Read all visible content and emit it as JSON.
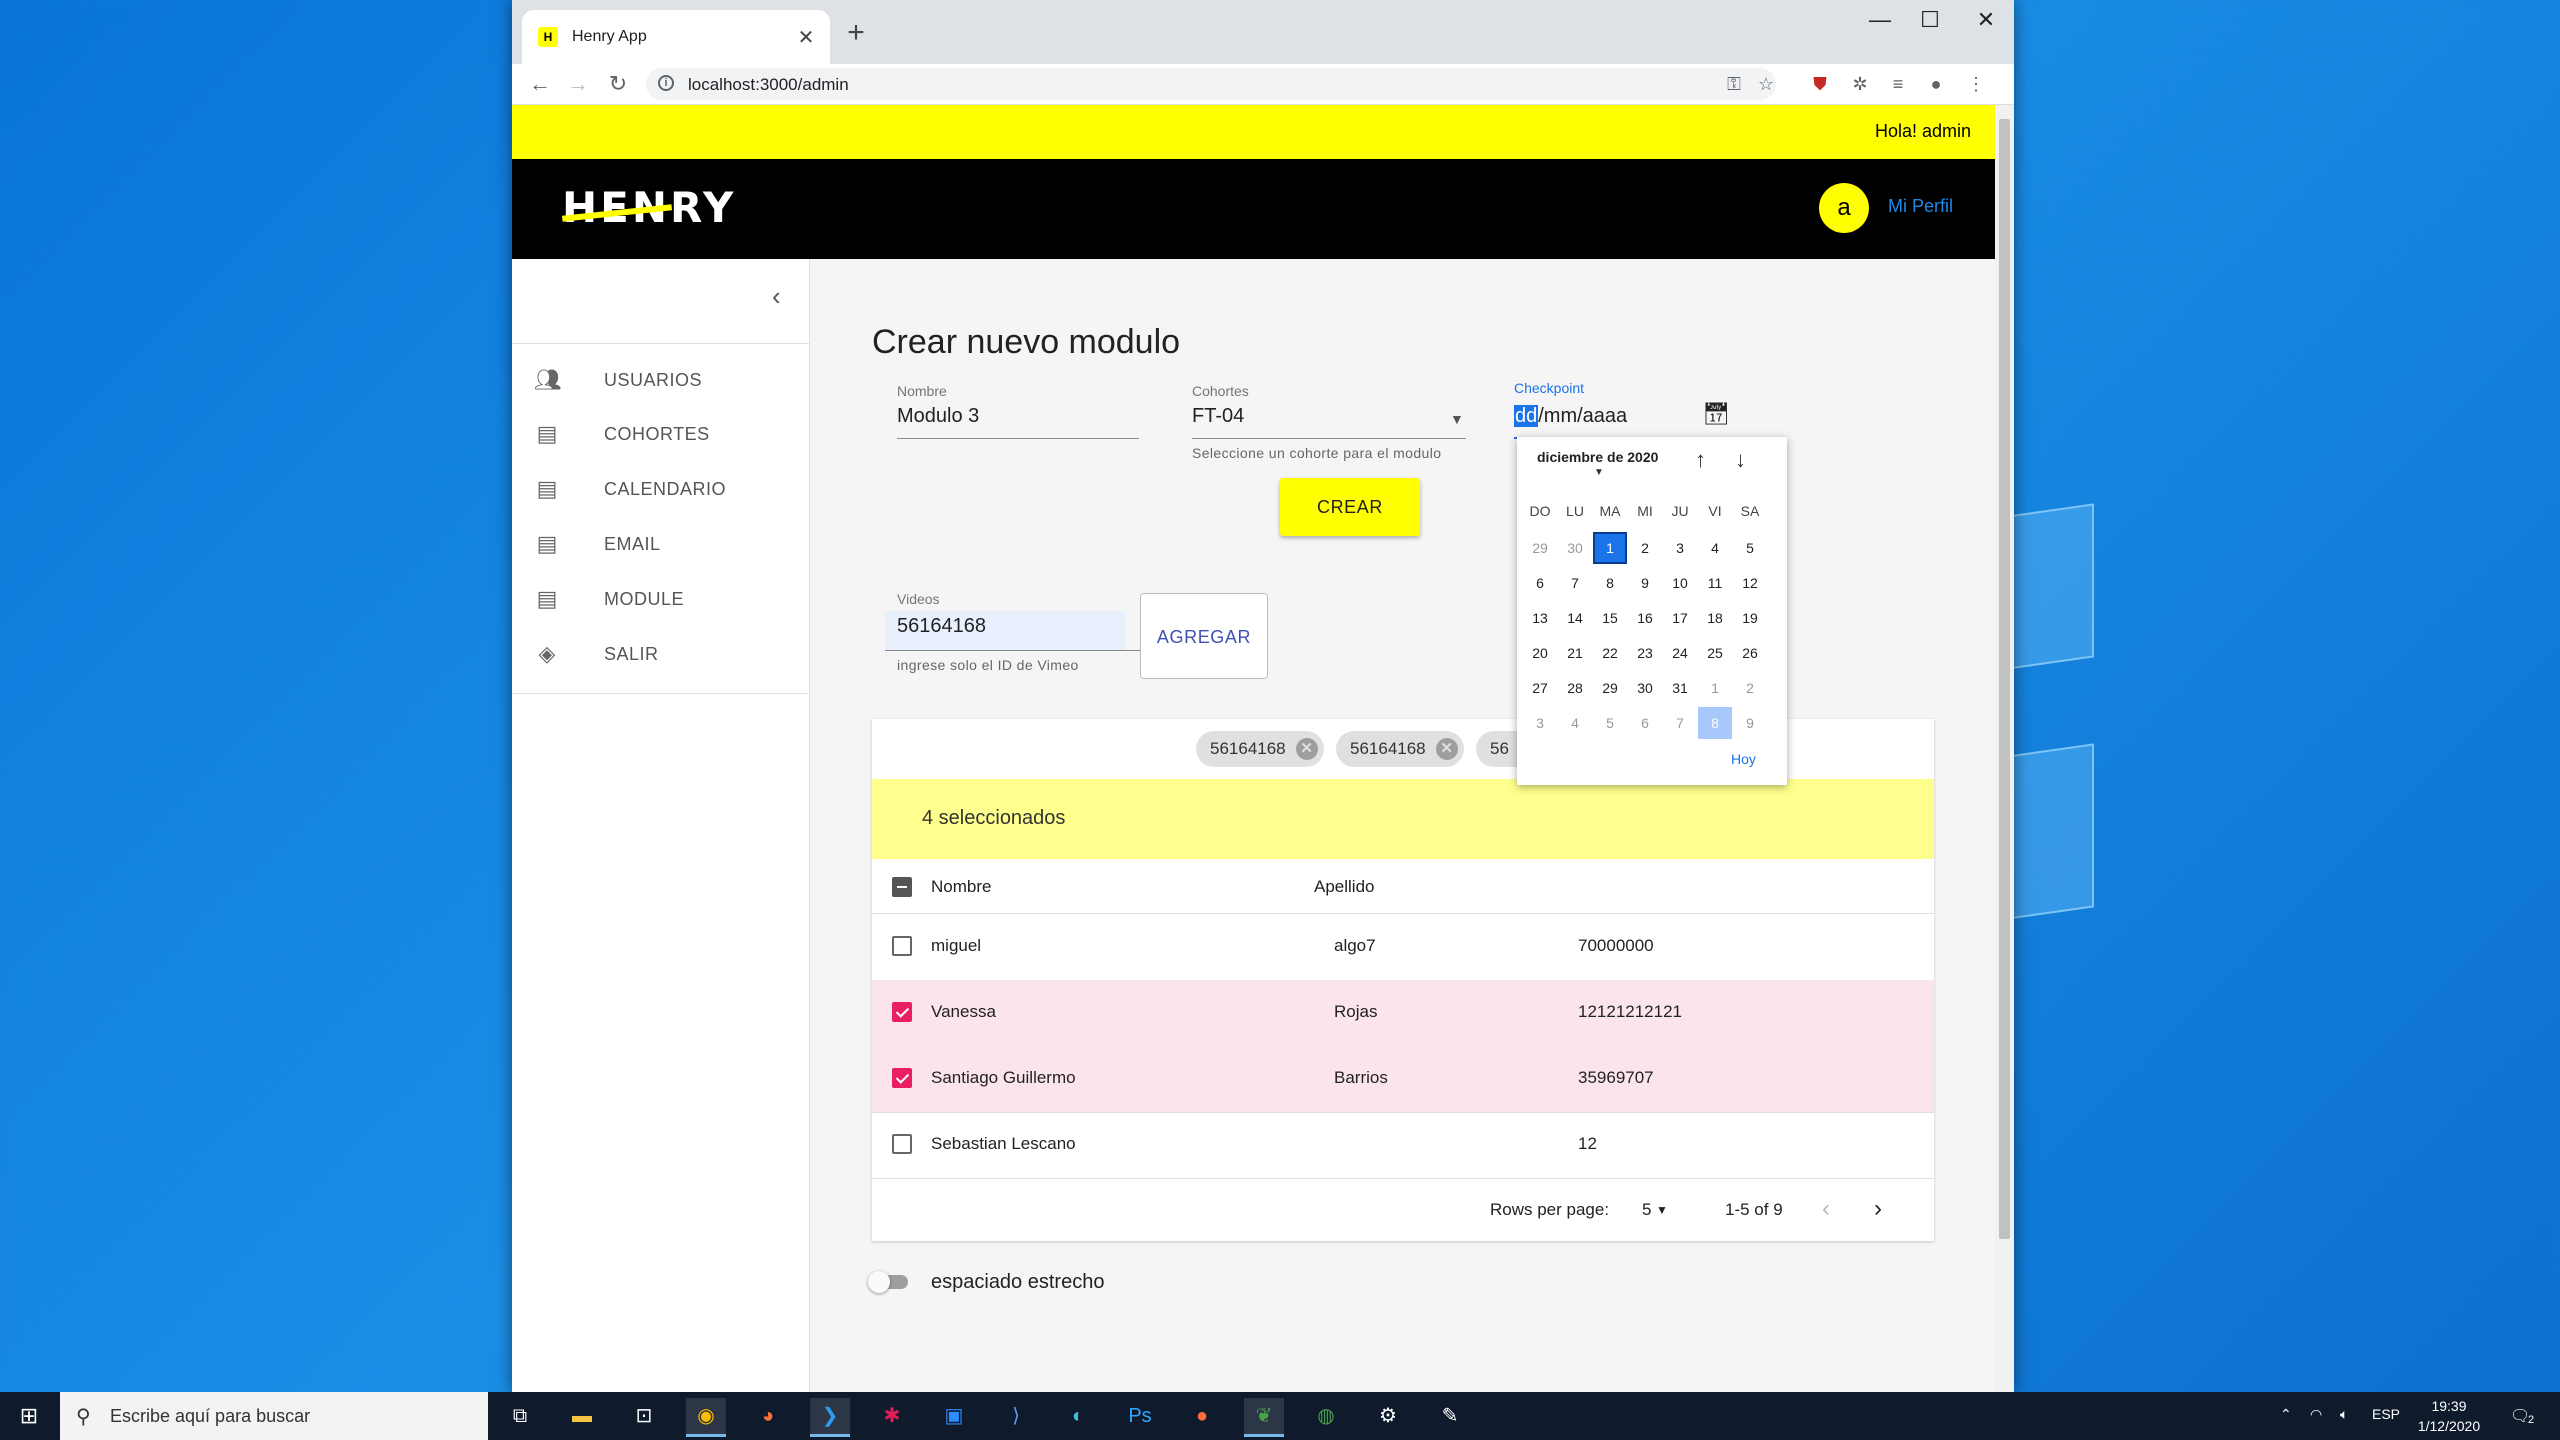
{
  "browser": {
    "tab_title": "Henry App",
    "tab_favicon": "H",
    "tab_close": "✕",
    "new_tab": "+",
    "win_minimize": "—",
    "win_maximize": "☐",
    "win_close": "✕",
    "url": "localhost:3000/admin"
  },
  "topbar": {
    "greeting": "Hola! admin"
  },
  "header": {
    "logo": "HENRY",
    "avatar_letter": "a",
    "profile_link": "Mi Perfil"
  },
  "sidebar": {
    "items": [
      {
        "label": "USUARIOS",
        "icon": "people-icon"
      },
      {
        "label": "COHORTES",
        "icon": "list-icon"
      },
      {
        "label": "CALENDARIO",
        "icon": "list-icon"
      },
      {
        "label": "EMAIL",
        "icon": "list-icon"
      },
      {
        "label": "MODULE",
        "icon": "list-icon"
      },
      {
        "label": "SALIR",
        "icon": "layers-icon"
      }
    ]
  },
  "form": {
    "title": "Crear nuevo modulo",
    "nombre_label": "Nombre",
    "nombre_value": "Modulo 3",
    "cohortes_label": "Cohortes",
    "cohortes_value": "FT-04",
    "cohortes_helper": "Seleccione un cohorte para el modulo",
    "checkpoint_label": "Checkpoint",
    "checkpoint_placeholder_sel": "dd",
    "checkpoint_placeholder_rest": "/mm/aaaa",
    "crear_label": "CREAR",
    "videos_label": "Videos",
    "videos_value": "56164168",
    "videos_helper": "ingrese solo el ID de Vimeo",
    "agregar_label": "AGREGAR"
  },
  "chips": [
    "56164168",
    "56164168",
    "56"
  ],
  "table": {
    "selected_text": "4 seleccionados",
    "headers": [
      "Nombre",
      "Apellido"
    ],
    "rows": [
      {
        "nombre": "miguel",
        "apellido": "algo7",
        "dni": "70000000",
        "checked": false
      },
      {
        "nombre": "Vanessa",
        "apellido": "Rojas",
        "dni": "12121212121",
        "checked": true
      },
      {
        "nombre": "Santiago Guillermo",
        "apellido": "Barrios",
        "dni": "35969707",
        "checked": true
      },
      {
        "nombre": "Sebastian Lescano",
        "apellido": "",
        "dni": "12",
        "checked": false
      }
    ],
    "rows_per_page_label": "Rows per page:",
    "rows_per_page_value": "5",
    "range": "1-5 of 9"
  },
  "dense_toggle_label": "espaciado estrecho",
  "datepicker": {
    "month": "diciembre de 2020",
    "dow": [
      "DO",
      "LU",
      "MA",
      "MI",
      "JU",
      "VI",
      "SA"
    ],
    "weeks": [
      [
        "29",
        "30",
        "1",
        "2",
        "3",
        "4",
        "5"
      ],
      [
        "6",
        "7",
        "8",
        "9",
        "10",
        "11",
        "12"
      ],
      [
        "13",
        "14",
        "15",
        "16",
        "17",
        "18",
        "19"
      ],
      [
        "20",
        "21",
        "22",
        "23",
        "24",
        "25",
        "26"
      ],
      [
        "27",
        "28",
        "29",
        "30",
        "31",
        "1",
        "2"
      ],
      [
        "3",
        "4",
        "5",
        "6",
        "7",
        "8",
        "9"
      ]
    ],
    "today_label": "Hoy"
  },
  "taskbar": {
    "search_placeholder": "Escribe aquí para buscar",
    "language": "ESP",
    "time": "19:39",
    "date": "1/12/2020",
    "notifications": "2"
  },
  "colors": {
    "brand_yellow": "#ffff01",
    "selected_row": "#fce4ec",
    "accent_pink": "#e91e63",
    "link_blue": "#1e88e5"
  }
}
